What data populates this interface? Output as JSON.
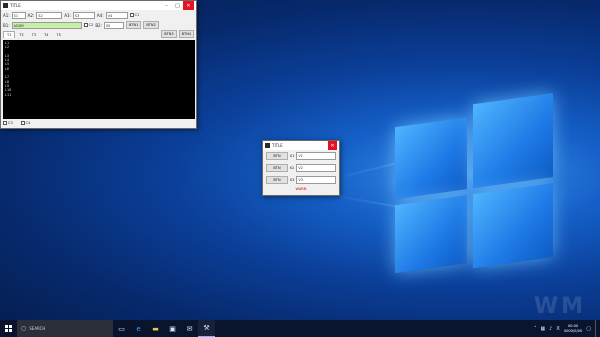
{
  "main_window": {
    "title": "TITLE",
    "row1": {
      "label1": "A1:",
      "select1": "S1",
      "label2": "A2:",
      "select2": "S2",
      "label3": "A3:",
      "select3": "S3",
      "label4": "A4:",
      "input4": "V4",
      "check1": "C1"
    },
    "row2": {
      "label": "B1:",
      "address": "ADDR",
      "check2": "C2",
      "label2": "B2:",
      "select": "S5",
      "button": "BTN1",
      "button2": "BTN2"
    },
    "tabs": [
      "T1",
      "T2",
      "T3",
      "T4",
      "T5"
    ],
    "buttons_right": [
      "BTN3",
      "BTN4"
    ],
    "console_lines": [
      "L1",
      "L2",
      "",
      "L3",
      "L4",
      "L5",
      "L6",
      "",
      "L7",
      "L8",
      "L9",
      "L10",
      "L11"
    ],
    "bottom_checks": [
      "C3",
      "C4"
    ]
  },
  "dialog": {
    "title": "TITLE",
    "rows": [
      {
        "button": "BTN",
        "label": "K1",
        "value": "V1"
      },
      {
        "button": "BTN",
        "label": "K2",
        "value": "V2"
      },
      {
        "button": "BTN",
        "label": "K3",
        "value": "V3"
      }
    ],
    "warning": "WARN"
  },
  "taskbar": {
    "search_placeholder": "SEARCH",
    "clock_time": "00:00",
    "clock_date": "0000/0/00",
    "tray_lang": "X",
    "icons": [
      "task-view-icon",
      "edge-icon",
      "explorer-icon",
      "store-icon",
      "mail-icon",
      "app-icon"
    ]
  },
  "watermark": "WM",
  "colors": {
    "accent": "#0078d7",
    "warning": "#e00000",
    "address_bg": "#c6f0a8"
  }
}
